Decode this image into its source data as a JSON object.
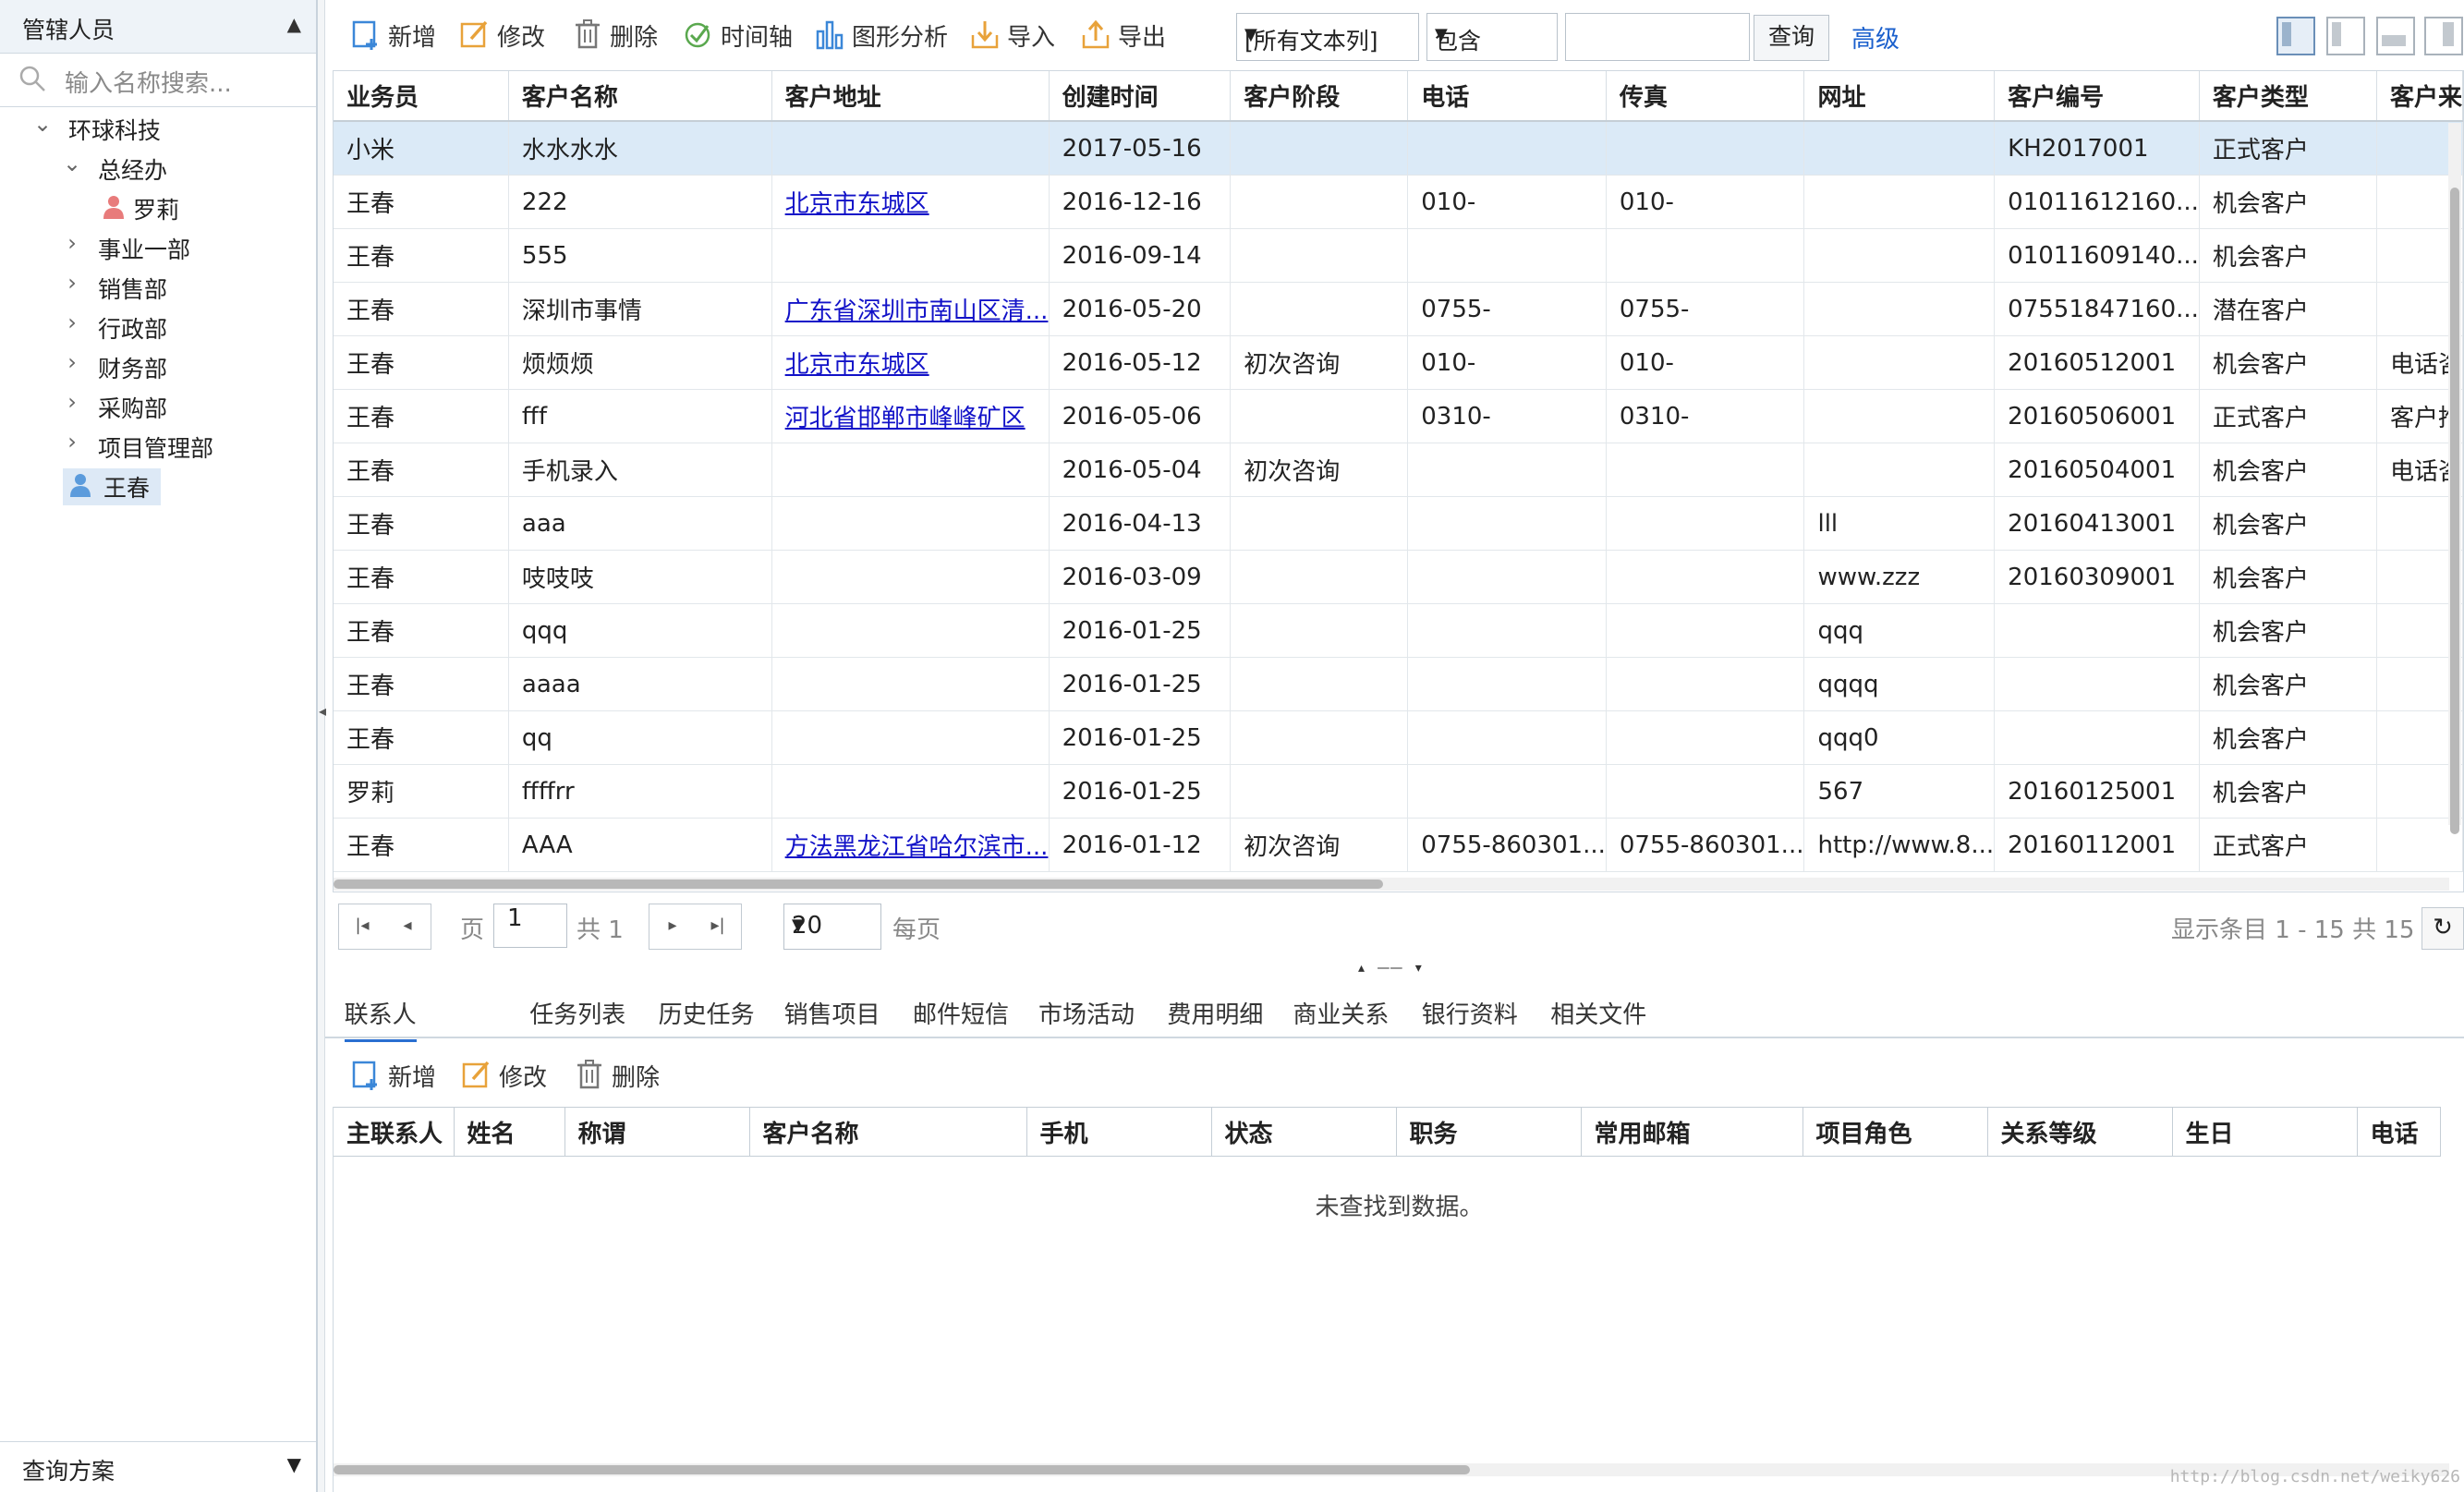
{
  "left_panel": {
    "title": "管辖人员",
    "search_placeholder": "输入名称搜索...",
    "tree": [
      {
        "label": "环球科技",
        "level": 0,
        "expanded": true
      },
      {
        "label": "总经办",
        "level": 1,
        "expanded": true
      },
      {
        "label": "罗莉",
        "level": 2,
        "type": "user"
      },
      {
        "label": "事业一部",
        "level": 1,
        "expanded": false
      },
      {
        "label": "销售部",
        "level": 1,
        "expanded": false
      },
      {
        "label": "行政部",
        "level": 1,
        "expanded": false
      },
      {
        "label": "财务部",
        "level": 1,
        "expanded": false
      },
      {
        "label": "采购部",
        "level": 1,
        "expanded": false
      },
      {
        "label": "项目管理部",
        "level": 1,
        "expanded": false
      },
      {
        "label": "王春",
        "level": 1,
        "type": "user",
        "selected": true
      }
    ],
    "footer_label": "查询方案"
  },
  "toolbar": {
    "add": "新增",
    "edit": "修改",
    "delete": "删除",
    "timeline": "时间轴",
    "chart_analysis": "图形分析",
    "import": "导入",
    "export": "导出",
    "column_select": "[所有文本列]",
    "operator_select": "包含",
    "search_value": "",
    "query": "查询",
    "advanced": "高级"
  },
  "grid": {
    "columns": [
      "业务员",
      "客户名称",
      "客户地址",
      "创建时间",
      "客户阶段",
      "电话",
      "传真",
      "网址",
      "客户编号",
      "客户类型",
      "客户来"
    ],
    "rows": [
      [
        "小米",
        "水水水水",
        "",
        "2017-05-16",
        "",
        "",
        "",
        "",
        "KH2017001",
        "正式客户",
        ""
      ],
      [
        "王春",
        "222",
        "北京市东城区",
        "2016-12-16",
        "",
        "010-",
        "010-",
        "",
        "01011612160...",
        "机会客户",
        ""
      ],
      [
        "王春",
        "555",
        "",
        "2016-09-14",
        "",
        "",
        "",
        "",
        "01011609140...",
        "机会客户",
        ""
      ],
      [
        "王春",
        "深圳市事情",
        "广东省深圳市南山区清...",
        "2016-05-20",
        "",
        "0755-",
        "0755-",
        "",
        "07551847160...",
        "潜在客户",
        ""
      ],
      [
        "王春",
        "烦烦烦",
        "北京市东城区",
        "2016-05-12",
        "初次咨询",
        "010-",
        "010-",
        "",
        "20160512001",
        "机会客户",
        "电话咨"
      ],
      [
        "王春",
        "fff",
        "河北省邯郸市峰峰矿区",
        "2016-05-06",
        "",
        "0310-",
        "0310-",
        "",
        "20160506001",
        "正式客户",
        "客户推"
      ],
      [
        "王春",
        "手机录入",
        "",
        "2016-05-04",
        "初次咨询",
        "",
        "",
        "",
        "20160504001",
        "机会客户",
        "电话咨"
      ],
      [
        "王春",
        "aaa",
        "",
        "2016-04-13",
        "",
        "",
        "",
        "lll",
        "20160413001",
        "机会客户",
        ""
      ],
      [
        "王春",
        "吱吱吱",
        "",
        "2016-03-09",
        "",
        "",
        "",
        "www.zzz",
        "20160309001",
        "机会客户",
        ""
      ],
      [
        "王春",
        "qqq",
        "",
        "2016-01-25",
        "",
        "",
        "",
        "qqq",
        "",
        "机会客户",
        ""
      ],
      [
        "王春",
        "aaaa",
        "",
        "2016-01-25",
        "",
        "",
        "",
        "qqqq",
        "",
        "机会客户",
        ""
      ],
      [
        "王春",
        "qq",
        "",
        "2016-01-25",
        "",
        "",
        "",
        "qqq0",
        "",
        "机会客户",
        ""
      ],
      [
        "罗莉",
        "ffffrr",
        "",
        "2016-01-25",
        "",
        "",
        "",
        "567",
        "20160125001",
        "机会客户",
        ""
      ],
      [
        "王春",
        "AAA",
        "方法黑龙江省哈尔滨市...",
        "2016-01-12",
        "初次咨询",
        "0755-860301...",
        "0755-860301...",
        "http://www.8...",
        "20160112001",
        "正式客户",
        ""
      ]
    ],
    "linked_address_rows": [
      1,
      3,
      4,
      5,
      13
    ]
  },
  "pager": {
    "page_label": "页",
    "current_page": "1",
    "total_label": "共 1",
    "page_size": "20",
    "per_page_label": "每页",
    "summary": "显示条目 1 - 15 共 15"
  },
  "tabs": [
    "联系人",
    "任务列表",
    "历史任务",
    "销售项目",
    "邮件短信",
    "市场活动",
    "费用明细",
    "商业关系",
    "银行资料",
    "相关文件"
  ],
  "sub_toolbar": {
    "add": "新增",
    "edit": "修改",
    "delete": "删除"
  },
  "sub_grid": {
    "columns": [
      "主联系人",
      "姓名",
      "称谓",
      "客户名称",
      "手机",
      "状态",
      "职务",
      "常用邮箱",
      "项目角色",
      "关系等级",
      "生日",
      "电话"
    ],
    "empty_text": "未查找到数据。"
  },
  "watermark": "http://blog.csdn.net/weiky626",
  "colors": {
    "accent": "#2a6fd1",
    "selected_row": "#dbeaf7",
    "link": "#1212c8",
    "add_icon": "#3b87d8",
    "edit_icon": "#e8a23a",
    "check_icon": "#5aa84e"
  }
}
